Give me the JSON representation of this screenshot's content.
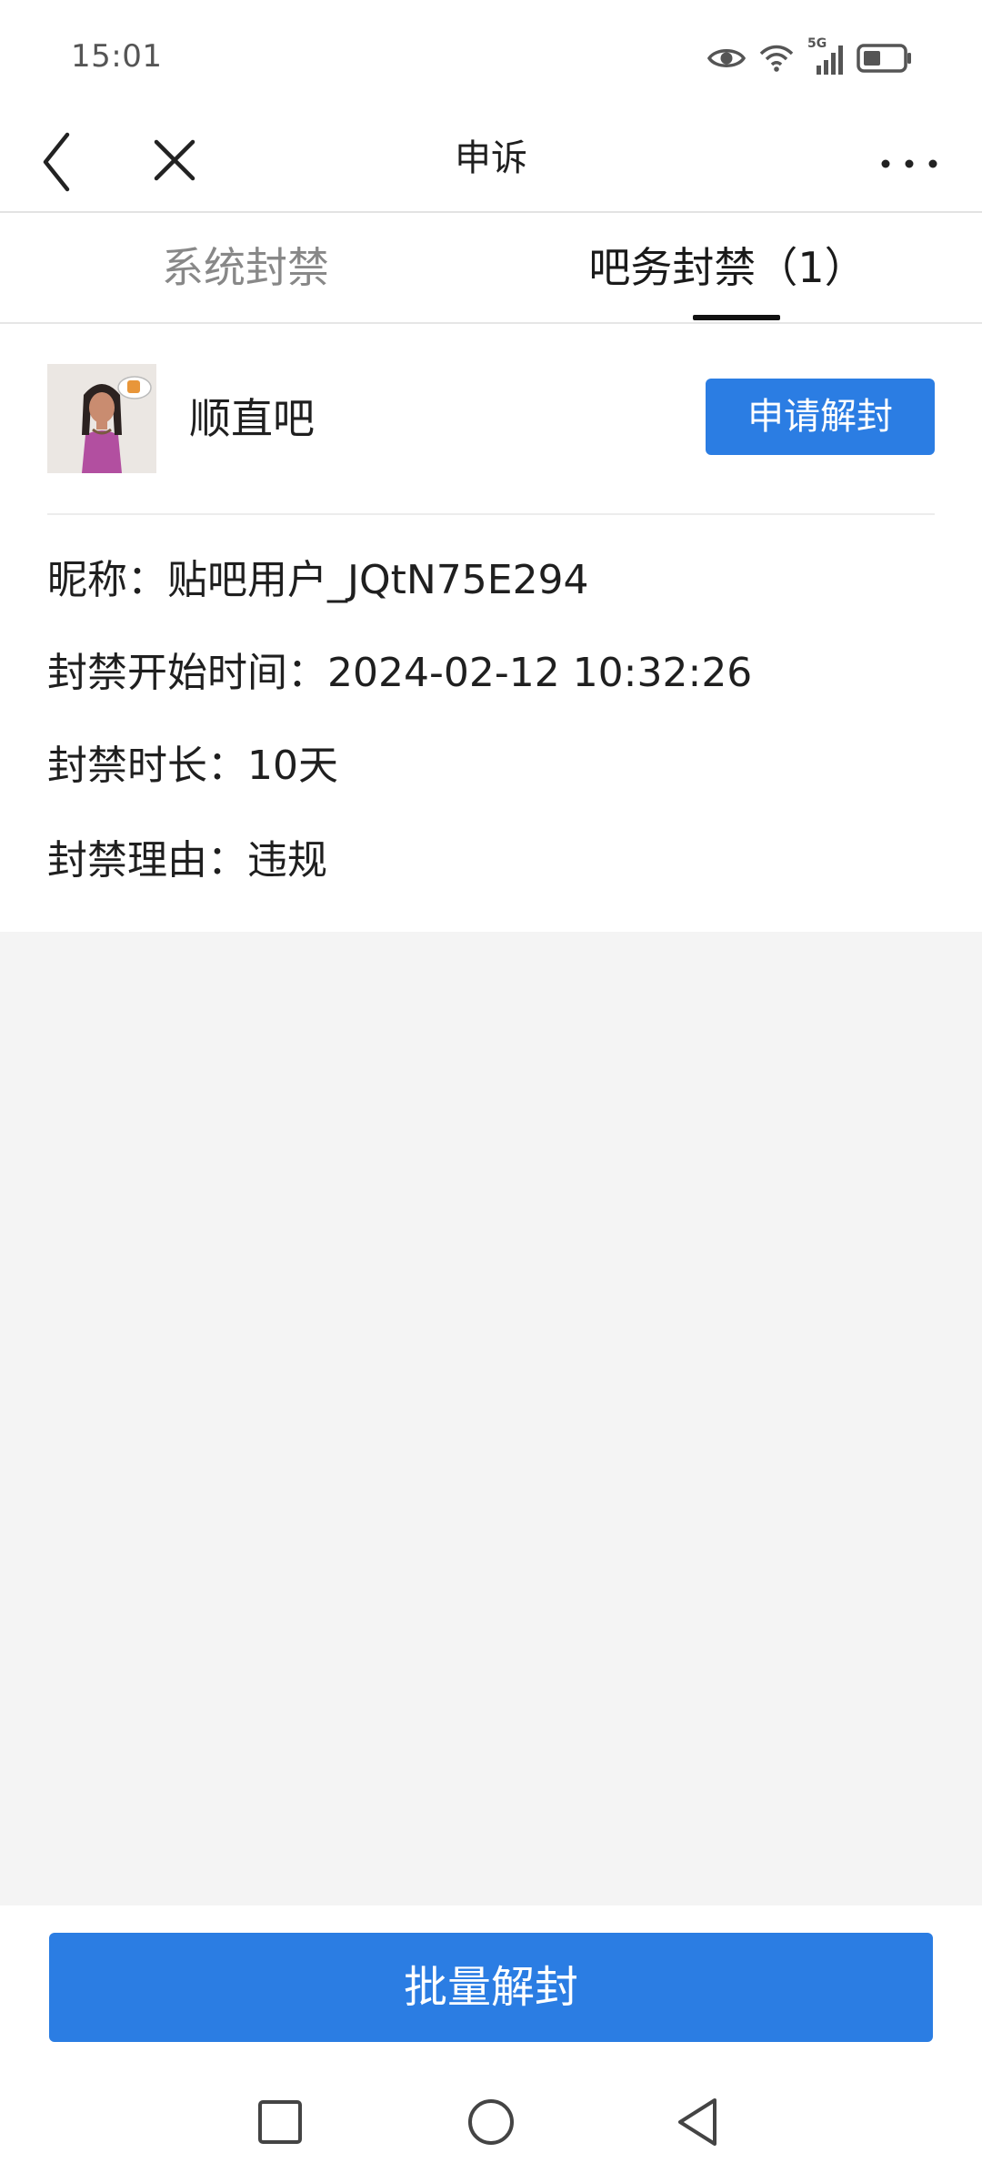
{
  "status_bar": {
    "time": "15:01",
    "network": "5G"
  },
  "header": {
    "title": "申诉"
  },
  "tabs": [
    {
      "label": "系统封禁",
      "active": false
    },
    {
      "label": "吧务封禁（1）",
      "active": true
    }
  ],
  "ban": {
    "forum_name": "顺直吧",
    "appeal_button": "申请解封",
    "nickname_line": "昵称：贴吧用户_JQtN75E294",
    "start_time_line": "封禁开始时间：2024-02-12 10:32:26",
    "duration_line": "封禁时长：10天",
    "reason_line": "封禁理由：违规"
  },
  "bottom": {
    "batch_button": "批量解封"
  },
  "colors": {
    "accent": "#2b7de3",
    "background": "#f4f4f4",
    "card": "#ffffff",
    "tab_inactive": "#888888"
  },
  "icons": {
    "back": "chevron-left-icon",
    "close": "close-icon",
    "more": "more-horizontal-icon",
    "eye": "eye-icon",
    "wifi": "wifi-icon",
    "signal": "signal-icon",
    "battery": "battery-icon"
  }
}
